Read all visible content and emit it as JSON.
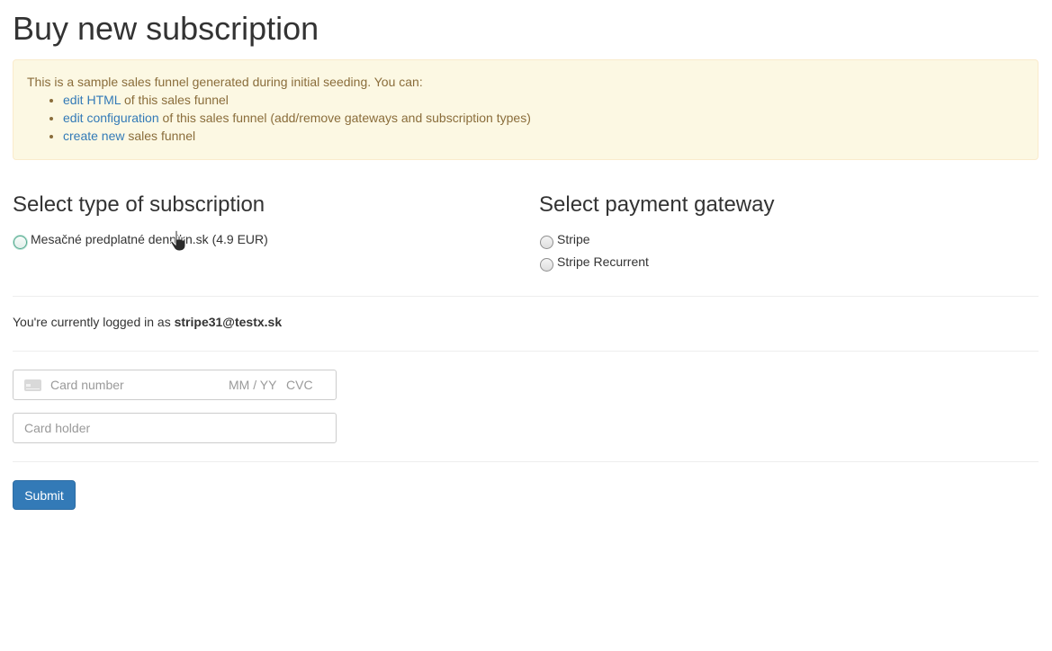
{
  "page": {
    "title": "Buy new subscription"
  },
  "notice": {
    "intro": "This is a sample sales funnel generated during initial seeding. You can:",
    "items": [
      {
        "link": "edit HTML",
        "rest": " of this sales funnel"
      },
      {
        "link": "edit configuration",
        "rest": " of this sales funnel (add/remove gateways and subscription types)"
      },
      {
        "link": "create new",
        "rest": " sales funnel"
      }
    ]
  },
  "subscription": {
    "heading": "Select type of subscription",
    "options": [
      {
        "label": "Mesačné predplatné dennikn.sk (4.9 EUR)"
      }
    ]
  },
  "gateway": {
    "heading": "Select payment gateway",
    "options": [
      {
        "label": "Stripe"
      },
      {
        "label": "Stripe Recurrent"
      }
    ]
  },
  "user": {
    "prefix": "You're currently logged in as ",
    "email": "stripe31@testx.sk"
  },
  "card": {
    "number_placeholder": "Card number",
    "expiry_placeholder": "MM / YY",
    "cvc_placeholder": "CVC",
    "holder_placeholder": "Card holder"
  },
  "form": {
    "submit_label": "Submit"
  },
  "colors": {
    "notice_bg": "#fcf8e3",
    "notice_text": "#8a6d3b",
    "link": "#337ab7",
    "primary_button": "#337ab7"
  }
}
